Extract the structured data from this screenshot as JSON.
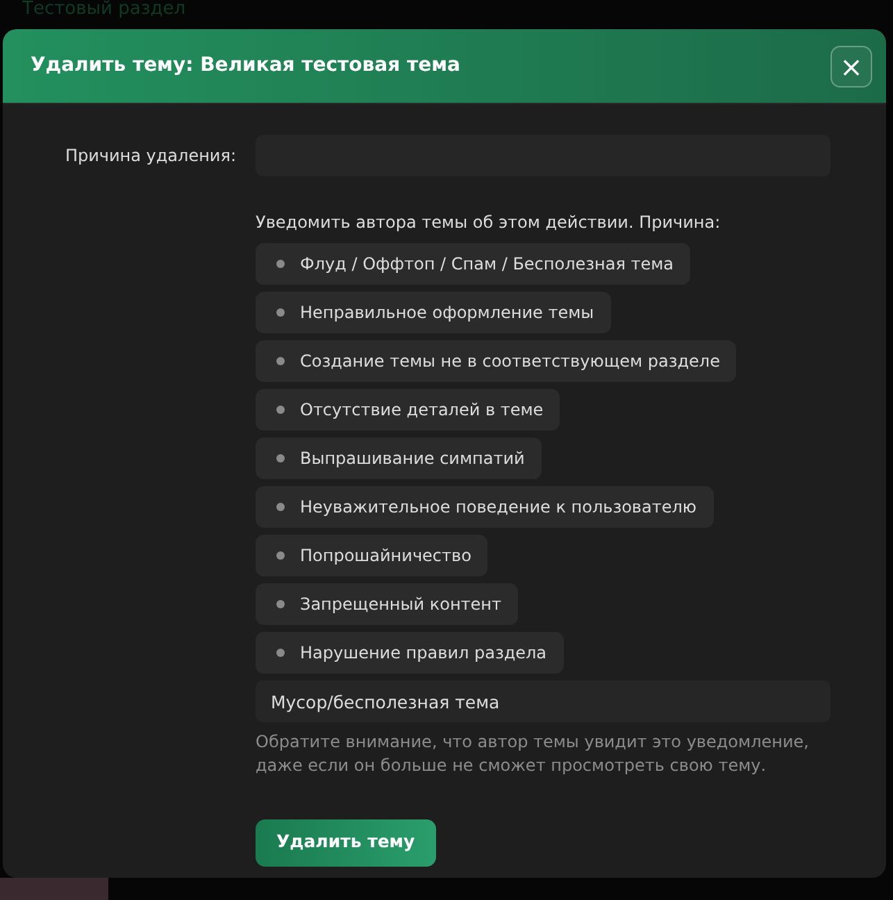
{
  "background": {
    "heading": "Тестовый раздел"
  },
  "modal": {
    "title": "Удалить тему: Великая тестовая тема",
    "close": "×"
  },
  "reason_field": {
    "label": "Причина удаления:"
  },
  "notify": {
    "label": "Уведомить автора темы об этом действии. Причина:",
    "options": [
      {
        "label": "Флуд / Оффтоп / Спам / Бесполезная тема",
        "selected": false
      },
      {
        "label": "Неправильное оформление темы",
        "selected": false
      },
      {
        "label": "Создание темы не в соответствующем разделе",
        "selected": false
      },
      {
        "label": "Отсутствие деталей в теме",
        "selected": false
      },
      {
        "label": "Выпрашивание симпатий",
        "selected": false
      },
      {
        "label": "Неуважительное поведение к пользователю",
        "selected": false
      },
      {
        "label": "Попрошайничество",
        "selected": false
      },
      {
        "label": "Запрещенный контент",
        "selected": false
      },
      {
        "label": "Нарушение правил раздела",
        "selected": false
      }
    ],
    "message": "Мусор/бесполезная тема",
    "note": "Обратите внимание, что автор темы увидит это уведомление, даже если он больше не сможет просмотреть свою тему."
  },
  "submit": "Удалить тему"
}
